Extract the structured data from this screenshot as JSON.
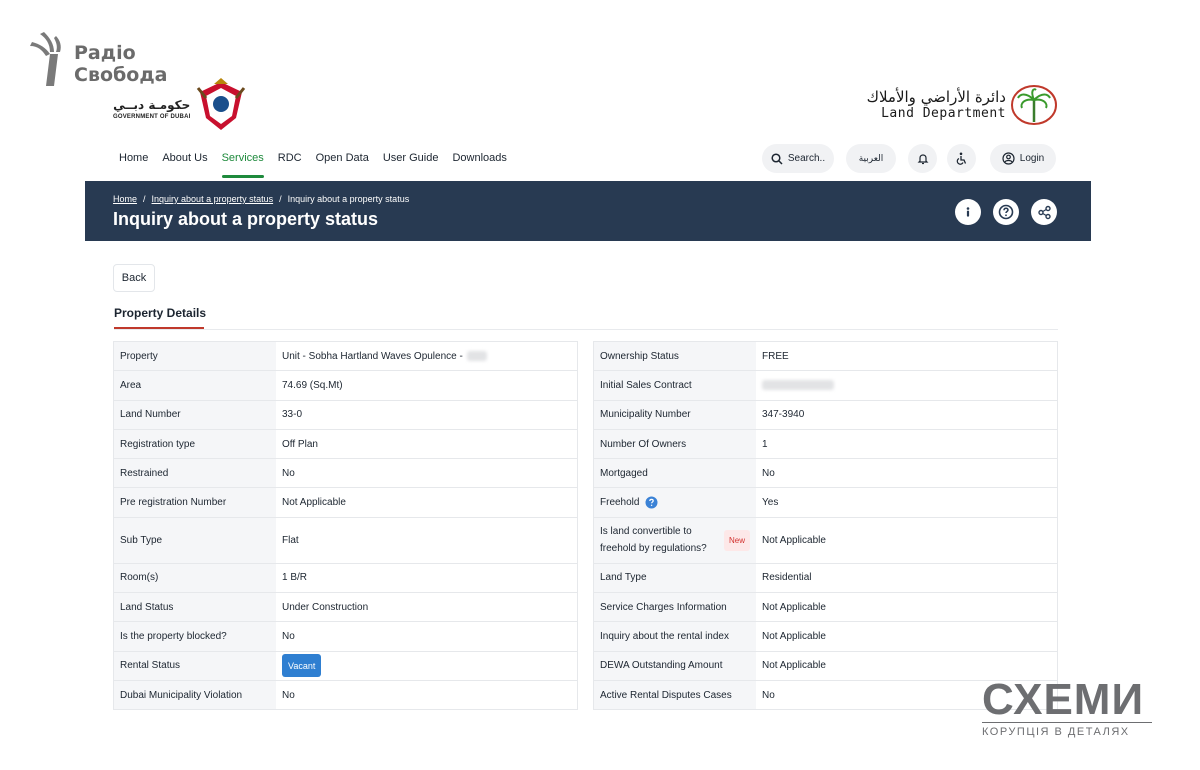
{
  "watermark_top": {
    "line1": "Радіо",
    "line2": "Свобода"
  },
  "gov_logo": {
    "arabic": "حكومـة دبــي",
    "english": "GOVERNMENT OF DUBAI"
  },
  "land_dept_logo": {
    "arabic": "دائرة الأراضي والأملاك",
    "english": "Land Department"
  },
  "nav": {
    "items": [
      {
        "label": "Home",
        "active": false
      },
      {
        "label": "About Us",
        "active": false
      },
      {
        "label": "Services",
        "active": true
      },
      {
        "label": "RDC",
        "active": false
      },
      {
        "label": "Open Data",
        "active": false
      },
      {
        "label": "User Guide",
        "active": false
      },
      {
        "label": "Downloads",
        "active": false
      }
    ],
    "search_label": "Search..",
    "arabic_label": "العربية",
    "login_label": "Login"
  },
  "banner": {
    "breadcrumb": [
      "Home",
      "Inquiry about a property status",
      "Inquiry about a property status"
    ],
    "separator": "/",
    "title": "Inquiry about a property status"
  },
  "back_label": "Back",
  "section_title": "Property Details",
  "left_table": [
    {
      "key": "Property",
      "value": "Unit - Sobha Hartland Waves Opulence -"
    },
    {
      "key": "Area",
      "value": "74.69 (Sq.Mt)"
    },
    {
      "key": "Land Number",
      "value": "33-0"
    },
    {
      "key": "Registration type",
      "value": "Off Plan"
    },
    {
      "key": "Restrained",
      "value": "No"
    },
    {
      "key": "Pre registration Number",
      "value": "Not Applicable"
    },
    {
      "key": "Sub Type",
      "value": "Flat"
    },
    {
      "key": "Room(s)",
      "value": "1 B/R"
    },
    {
      "key": "Land Status",
      "value": "Under Construction"
    },
    {
      "key": "Is the property blocked?",
      "value": "No"
    },
    {
      "key": "Rental Status",
      "value": "Vacant"
    },
    {
      "key": "Dubai Municipality Violation",
      "value": "No"
    }
  ],
  "right_table": [
    {
      "key": "Ownership Status",
      "value": "FREE"
    },
    {
      "key": "Initial Sales Contract",
      "value": ""
    },
    {
      "key": "Municipality Number",
      "value": "347-3940"
    },
    {
      "key": "Number Of Owners",
      "value": "1"
    },
    {
      "key": "Mortgaged",
      "value": "No"
    },
    {
      "key": "Freehold",
      "value": "Yes"
    },
    {
      "key": "Is land convertible to freehold by regulations?",
      "value": "Not Applicable",
      "badge": "New"
    },
    {
      "key": "Land Type",
      "value": "Residential"
    },
    {
      "key": "Service Charges Information",
      "value": "Not Applicable"
    },
    {
      "key": "Inquiry about the rental index",
      "value": "Not Applicable"
    },
    {
      "key": "DEWA Outstanding Amount",
      "value": "Not Applicable"
    },
    {
      "key": "Active Rental Disputes Cases",
      "value": "No"
    }
  ],
  "watermark_bottom": {
    "big": "СХЕМИ",
    "small": "КОРУПЦІЯ В ДЕТАЛЯХ"
  },
  "colors": {
    "banner": "#283a52",
    "active_nav": "#1e8a3c",
    "vacant": "#2f7fd1",
    "accent_red": "#c0392b"
  }
}
